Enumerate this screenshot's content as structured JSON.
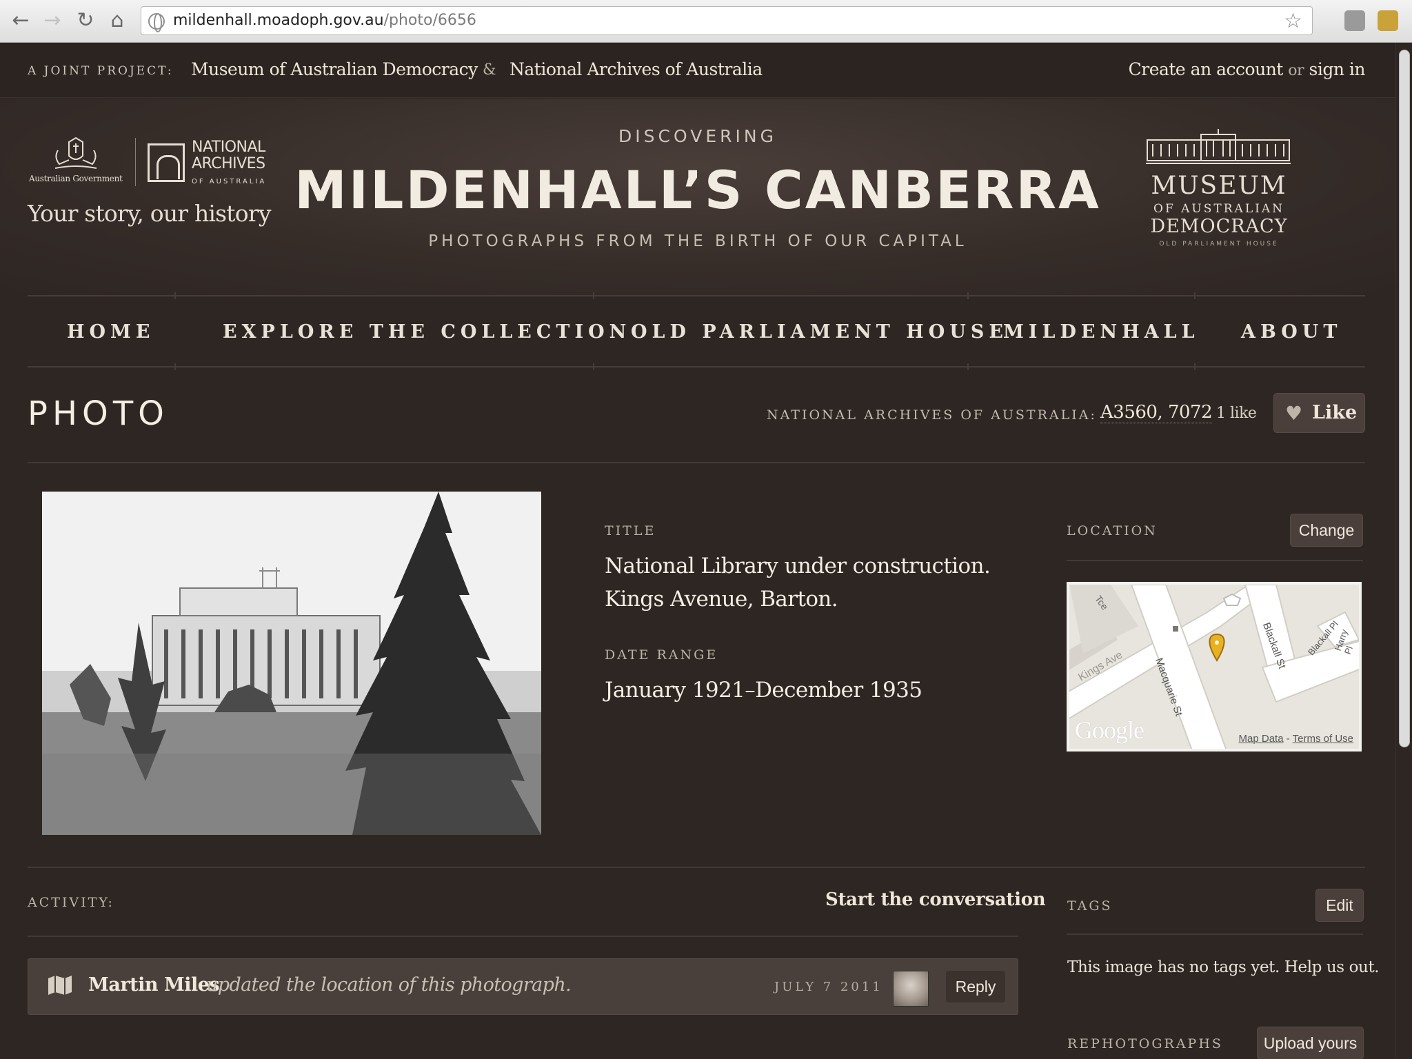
{
  "browser": {
    "url_host": "mildenhall.moadoph.gov.au",
    "url_path": "/photo/6656"
  },
  "topbar": {
    "joint_label": "A JOINT PROJECT:",
    "link_moad": "Museum of Australian Democracy",
    "amp": "&",
    "link_naa": "National Archives of Australia",
    "create_account": "Create an account",
    "or": "or",
    "sign_in": "sign in"
  },
  "header": {
    "gov_text": "Australian Government",
    "naa_line1": "NATIONAL",
    "naa_line2": "ARCHIVES",
    "naa_line3": "OF AUSTRALIA",
    "tagline": "Your story, our history",
    "discovering": "DISCOVERING",
    "title": "MILDENHALL’S CANBERRA",
    "subtitle": "PHOTOGRAPHS FROM THE BIRTH OF OUR CAPITAL",
    "moad_line1": "MUSEUM",
    "moad_line2": "OF AUSTRALIAN",
    "moad_line3": "DEMOCRACY",
    "moad_line4": "OLD PARLIAMENT HOUSE"
  },
  "nav": {
    "items": [
      {
        "label": "HOME"
      },
      {
        "label": "EXPLORE THE COLLECTION"
      },
      {
        "label": "OLD PARLIAMENT HOUSE"
      },
      {
        "label": "MILDENHALL"
      },
      {
        "label": "ABOUT"
      }
    ]
  },
  "photo_page": {
    "heading": "PHOTO",
    "naa_label": "NATIONAL ARCHIVES OF AUSTRALIA:",
    "naa_ref": "A3560, 7072",
    "like_count": "1 like",
    "like_label": "Like",
    "title_label": "TITLE",
    "title_line1": "National Library under construction.",
    "title_line2": "Kings Avenue, Barton.",
    "date_label": "DATE RANGE",
    "date_value": "January 1921–December 1935",
    "location_label": "LOCATION",
    "change_label": "Change",
    "map": {
      "streets": [
        "Kings Ave",
        "Macquarie St",
        "Blackall St",
        "Blackall Pl",
        "Harry Pl",
        "Tce"
      ],
      "google": "Google",
      "map_data": "Map Data",
      "dash": "-",
      "terms": "Terms of Use"
    }
  },
  "activity": {
    "label": "ACTIVITY:",
    "start_conversation": "Start the conversation",
    "entries": [
      {
        "user": "Martin Miles",
        "action": "updated the location of this photograph.",
        "date": "JULY 7 2011",
        "reply": "Reply"
      }
    ]
  },
  "tags": {
    "label": "TAGS",
    "edit": "Edit",
    "empty_note": "This image has no tags yet. Help us out."
  },
  "rephotographs": {
    "label": "REPHOTOGRAPHS",
    "upload": "Upload yours"
  },
  "colors": {
    "page_bg": "#2e2623",
    "header_glow": "#4a3e39",
    "text_light": "#f4ede3",
    "button_bg": "#4a3f3a",
    "map_pin": "#e8b023"
  }
}
